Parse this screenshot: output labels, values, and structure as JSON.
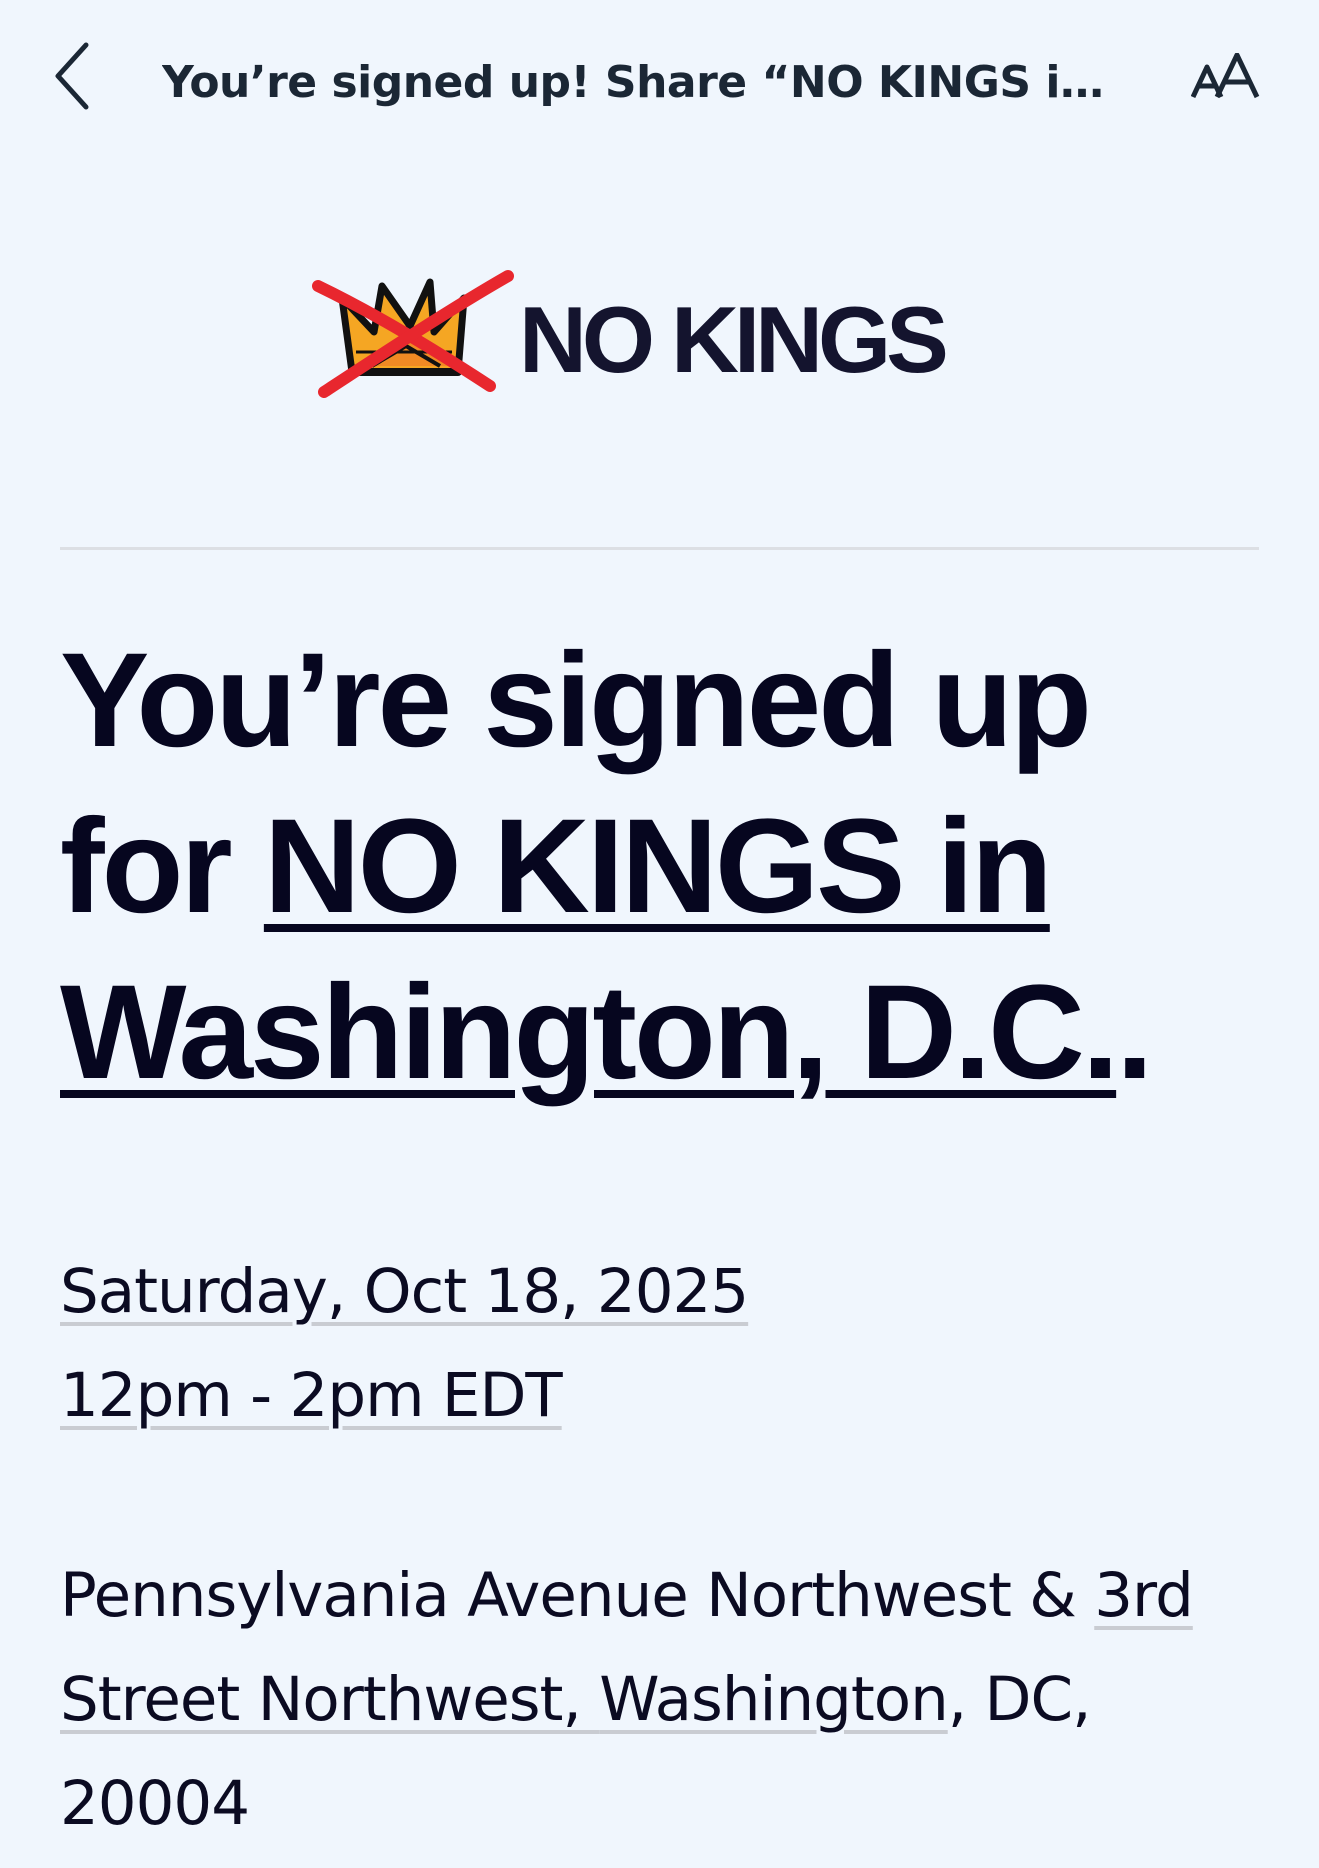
{
  "nav": {
    "back_icon": "chevron-left-icon",
    "title": "You’re signed up! Share “NO KINGS in Washington, D.C.”",
    "text_size_icon": "text-size-icon",
    "text_size_label": "AA"
  },
  "logo": {
    "mark_icon": "crossed-crown-icon",
    "text": "NO KINGS",
    "colors": {
      "cross": "#e8272e",
      "crown_outline": "#111111",
      "crown_fill": "#f5a623",
      "wordmark": "#14142e"
    }
  },
  "headline": {
    "prefix": "You’re signed up for ",
    "event_link": "NO KINGS in Washington, D.C.",
    "suffix": "."
  },
  "event": {
    "date": "Saturday, Oct 18, 2025",
    "time": "12pm - 2pm EDT",
    "address_line1_a": "Pennsylvania Avenue Northwest & ",
    "address_line1_b": "3rd",
    "address_line2_a": "Street Northwest, ",
    "address_line2_b": "Washington",
    "address_line2_c": ", DC,",
    "address_line3": "20004"
  }
}
